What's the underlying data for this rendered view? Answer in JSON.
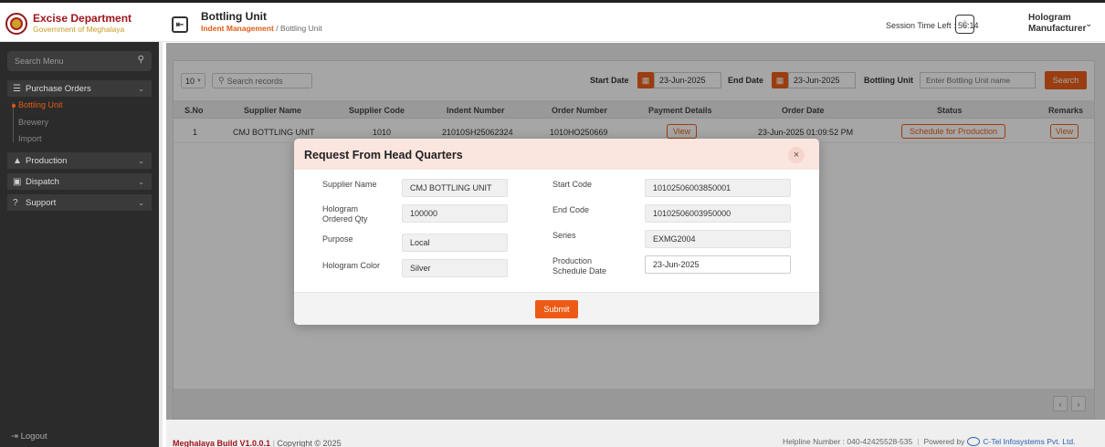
{
  "header": {
    "brand_title": "Excise Department",
    "brand_sub": "Government of Meghalaya",
    "page_title": "Bottling Unit",
    "crumb_parent": "Indent Management",
    "crumb_sep": "/",
    "crumb_current": "Bottling Unit",
    "session_text": "Session Time Left : 56:14",
    "user_line1": "Hologram",
    "user_line2": "Manufacturer"
  },
  "sidebar": {
    "search_placeholder": "Search Menu",
    "purchase_orders": "Purchase Orders",
    "sub_bottling": "Bottling Unit",
    "sub_brewery": "Brewery",
    "sub_import": "Import",
    "production": "Production",
    "dispatch": "Dispatch",
    "support": "Support",
    "logout": "Logout"
  },
  "toolbar": {
    "page_size": "10",
    "search_placeholder": "Search records",
    "start_label": "Start Date",
    "start_date": "23-Jun-2025",
    "end_label": "End Date",
    "end_date": "23-Jun-2025",
    "unit_label": "Bottling Unit",
    "unit_placeholder": "Enter Bottling Unit name",
    "search_btn": "Search"
  },
  "table": {
    "headers": [
      "S.No",
      "Supplier Name",
      "Supplier Code",
      "Indent Number",
      "Order Number",
      "Payment Details",
      "Order Date",
      "Status",
      "Remarks"
    ],
    "rows": [
      {
        "sno": "1",
        "supplier_name": "CMJ BOTTLING UNIT",
        "supplier_code": "1010",
        "indent_number": "21010SH25062324",
        "order_number": "1010HO250669",
        "payment": "View",
        "order_date": "23-Jun-2025 01:09:52 PM",
        "status": "Schedule for Production",
        "remarks": "View"
      }
    ]
  },
  "modal": {
    "title": "Request From Head Quarters",
    "supplier_name_label": "Supplier Name",
    "supplier_name": "CMJ BOTTLING UNIT",
    "qty_label_1": "Hologram",
    "qty_label_2": "Ordered Qty",
    "qty": "100000",
    "purpose_label": "Purpose",
    "purpose": "Local",
    "color_label": "Hologram Color",
    "color": "Silver",
    "start_code_label": "Start Code",
    "start_code": "10102506003850001",
    "end_code_label": "End Code",
    "end_code": "10102506003950000",
    "series_label": "Series",
    "series": "EXMG2004",
    "schedule_label_1": "Production",
    "schedule_label_2": "Schedule Date",
    "schedule_date": "23-Jun-2025",
    "submit": "Submit"
  },
  "footer": {
    "build": "Meghalaya Build V1.0.0.1",
    "copyright": "Copyright © 2025",
    "helpline": "Helpline Number : 040-42425528-535",
    "powered": "Powered by",
    "company": "C-Tel Infosystems Pvt. Ltd."
  },
  "colors": {
    "accent": "#ed5f1a",
    "brand": "#a0161c",
    "sidebar": "#2b2b2b"
  }
}
